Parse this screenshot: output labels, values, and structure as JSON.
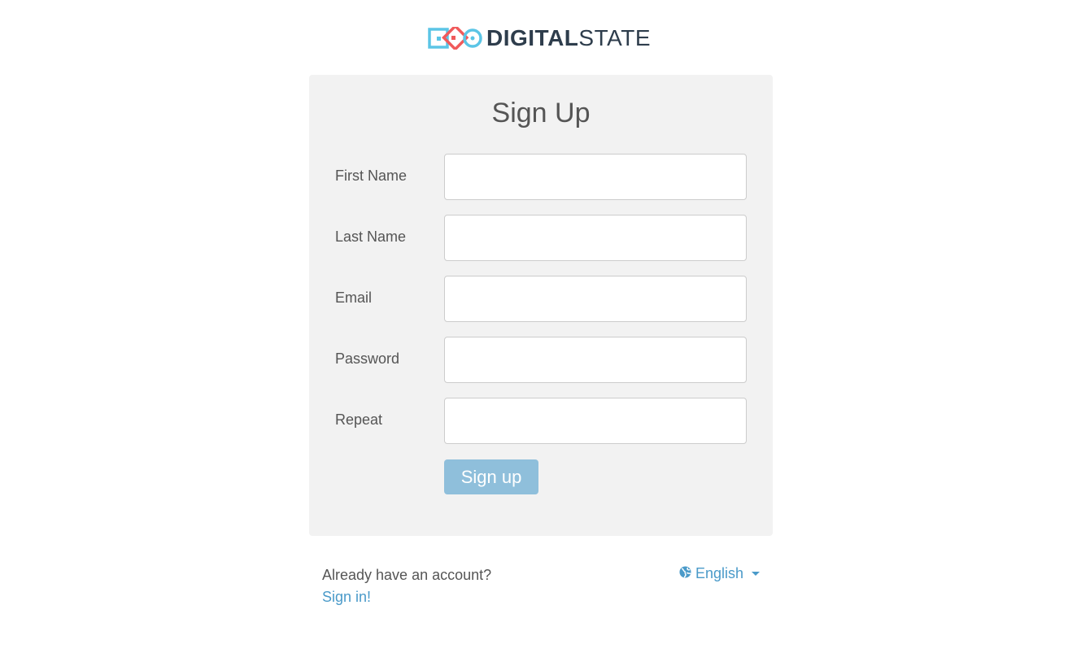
{
  "logo": {
    "text_bold": "DIGITAL",
    "text_light": "STATE",
    "colors": {
      "blue": "#5bc5e6",
      "red": "#f05a5b",
      "dark": "#2e3d4c"
    }
  },
  "form": {
    "title": "Sign Up",
    "fields": [
      {
        "label": "First Name",
        "value": "",
        "type": "text"
      },
      {
        "label": "Last Name",
        "value": "",
        "type": "text"
      },
      {
        "label": "Email",
        "value": "",
        "type": "email"
      },
      {
        "label": "Password",
        "value": "",
        "type": "password"
      },
      {
        "label": "Repeat",
        "value": "",
        "type": "password"
      }
    ],
    "submit_label": "Sign up",
    "submit_color": "#8fbfdb"
  },
  "footer": {
    "question": "Already have an account?",
    "signin_link": "Sign in!",
    "language": {
      "icon": "globe-icon",
      "selected": "English",
      "dropdown_icon": "caret-down-icon"
    },
    "link_color": "#4a9ac9"
  }
}
